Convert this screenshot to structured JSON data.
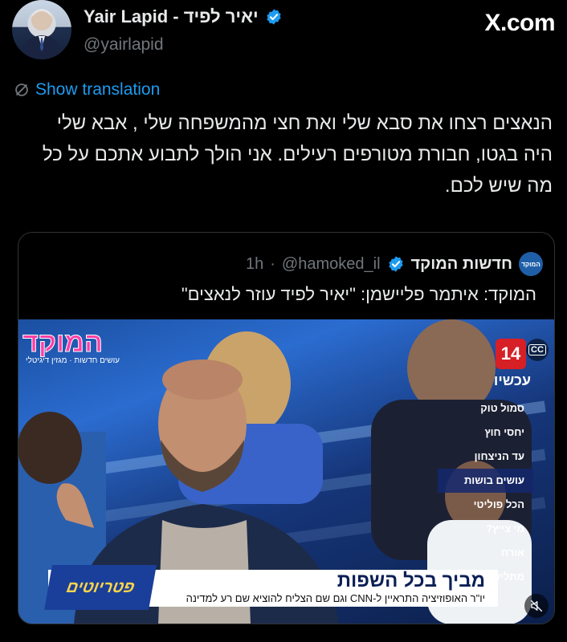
{
  "header": {
    "display_name": "Yair Lapid - יאיר לפיד",
    "handle": "@yairlapid",
    "site_brand": "X.com"
  },
  "translate": {
    "label": "Show translation"
  },
  "tweet": {
    "text": "הנאצים רצחו את סבא שלי ואת חצי מהמשפחה שלי , אבא שלי היה בגטו, חבורת מטורפים רעילים. אני הולך לתבוע אתכם על כל מה שיש לכם."
  },
  "quote": {
    "name": "חדשות המוקד",
    "handle": "@hamoked_il",
    "separator": "·",
    "time": "1h",
    "avatar_text": "המוקד",
    "text": "המוקד: איתמר פליישמן: \"יאיר לפיד עוזר לנאצים\""
  },
  "video": {
    "logo_title": "המוקד",
    "logo_sub": "עושים חדשות · מגזין דיגיטלי",
    "channel": "14",
    "cc": "CC",
    "now_label": "עכשיו",
    "menu": [
      {
        "label": "סמול טוק",
        "active": false
      },
      {
        "label": "יחסי חוץ",
        "active": false
      },
      {
        "label": "עד הניצחון",
        "active": false
      },
      {
        "label": "עושים בושות",
        "active": true
      },
      {
        "label": "הכל פוליטי",
        "active": false
      },
      {
        "label": "מי צייץ?",
        "active": false
      },
      {
        "label": "אורח",
        "active": false
      },
      {
        "label": "מתלישים",
        "active": false
      }
    ],
    "lower_third_title": "מביך בכל השפות",
    "lower_third_sub": "יו\"ר האופוזיציה התראיין ל-CNN וגם שם הצליח להוציא שם רע למדינה",
    "lower_third_badge": "פטריוטים"
  },
  "colors": {
    "background": "#000000",
    "text": "#e7e9ea",
    "muted": "#71767b",
    "link": "#1d9bf0",
    "verified": "#1d9bf0",
    "border": "#2f3336"
  }
}
